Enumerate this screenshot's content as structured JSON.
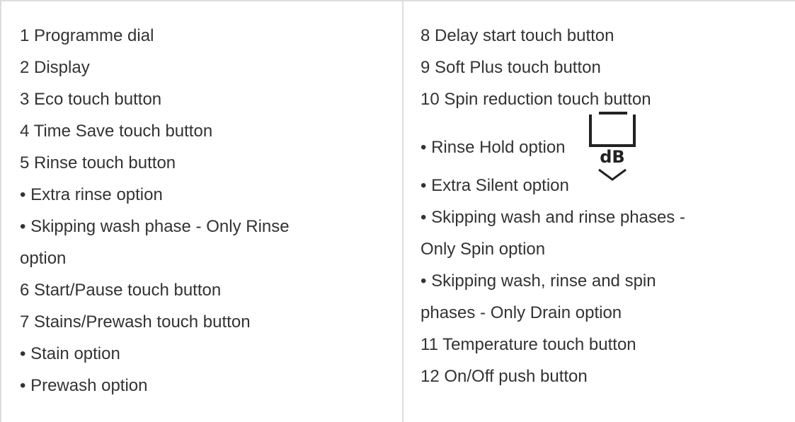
{
  "left_column": {
    "lines": [
      "1 Programme dial",
      "2 Display",
      "3 Eco touch button",
      "4 Time Save touch button",
      "5 Rinse touch button",
      "• Extra rinse option",
      "• Skipping wash phase - Only Rinse",
      "option",
      "6 Start/Pause touch button",
      "7 Stains/Prewash touch button",
      "• Stain option",
      "• Prewash option"
    ]
  },
  "right_column": {
    "lines": [
      "8 Delay start touch button",
      "9 Soft Plus touch button",
      "10 Spin reduction touch button",
      "• Rinse Hold option",
      "• Extra Silent option",
      "• Skipping wash and rinse phases -",
      "Only Spin option",
      "• Skipping wash, rinse and spin",
      "phases - Only Drain option",
      "11 Temperature touch button",
      "12 On/Off push button"
    ],
    "db_icon_text": "dB"
  },
  "icons": {
    "rinse_hold": "rinse-hold-icon",
    "extra_silent": "extra-silent-db-icon"
  }
}
